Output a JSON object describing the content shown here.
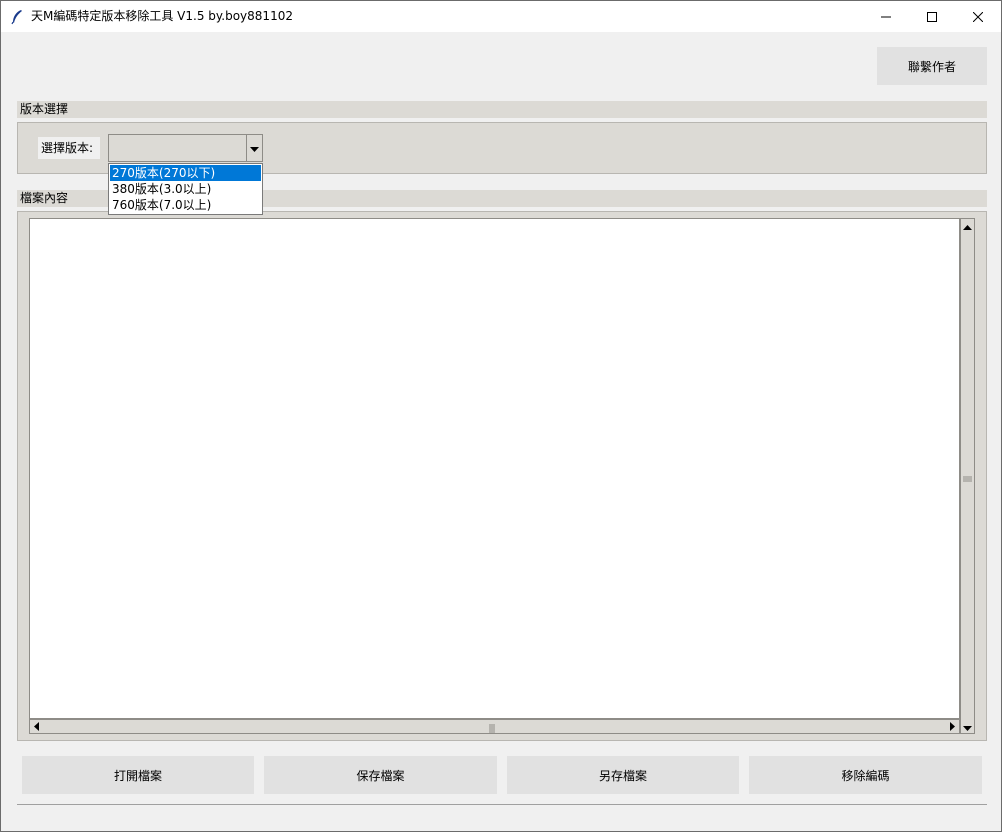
{
  "window": {
    "title": "天M編碼特定版本移除工具 V1.5 by.boy881102",
    "icon": "feather-icon",
    "controls": [
      "minimize-icon",
      "maximize-icon",
      "close-icon"
    ]
  },
  "header": {
    "contact_label": "聯繫作者"
  },
  "version_section": {
    "title": "版本選擇",
    "select_label": "選擇版本:",
    "selected_value": "",
    "options": [
      "270版本(270以下)",
      "380版本(3.0以上)",
      "760版本(7.0以上)"
    ],
    "highlighted_option": "270版本(270以下)"
  },
  "content_section": {
    "title": "檔案內容",
    "text": ""
  },
  "buttons": {
    "open_label": "打開檔案",
    "save_label": "保存檔案",
    "save_as_label": "另存檔案",
    "remove_label": "移除編碼"
  },
  "colors": {
    "highlight": "#0078d7",
    "panel": "#dcdad5",
    "button": "#e1e1e1",
    "window_bg": "#f0f0f0"
  }
}
